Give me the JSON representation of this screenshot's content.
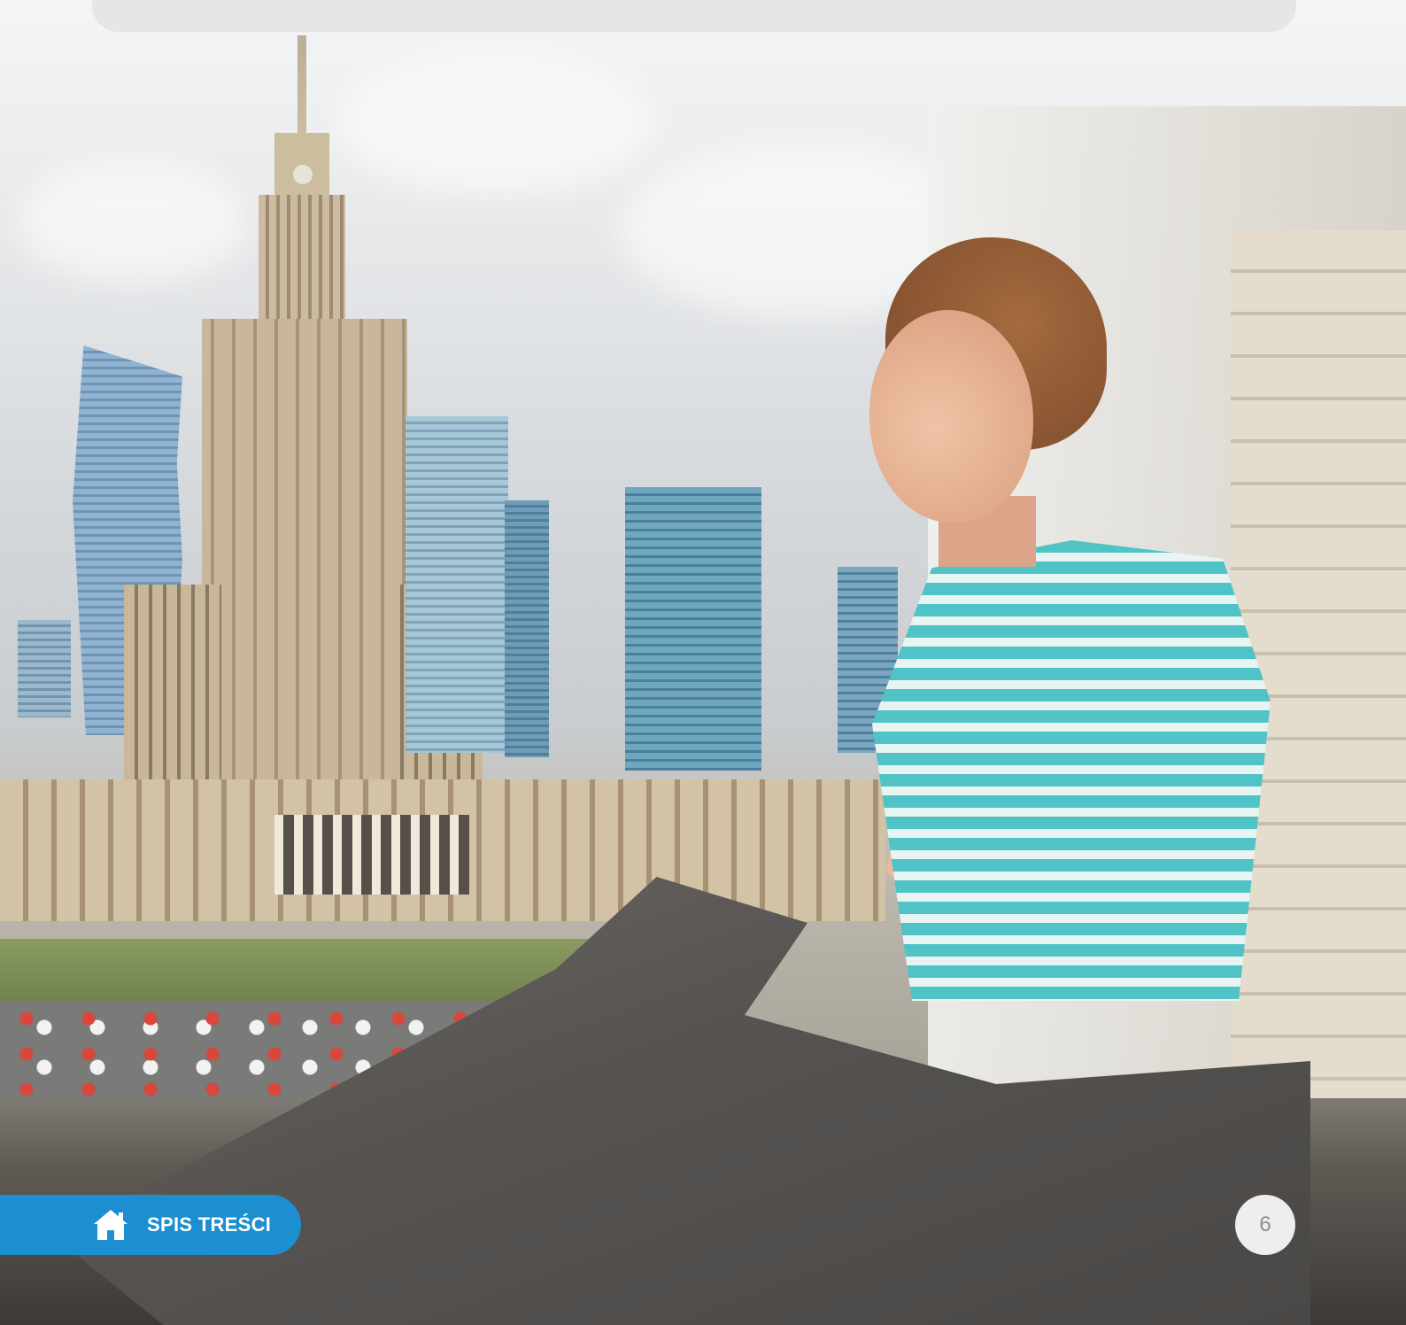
{
  "page": {
    "toc_button": {
      "label": "SPIS TREŚCI",
      "icon": "home-icon"
    },
    "page_number": "6"
  },
  "colors": {
    "toc_background": "#1d8fd1",
    "page_number_background": "#eeeeee",
    "top_box_background": "#e6e6e6"
  }
}
